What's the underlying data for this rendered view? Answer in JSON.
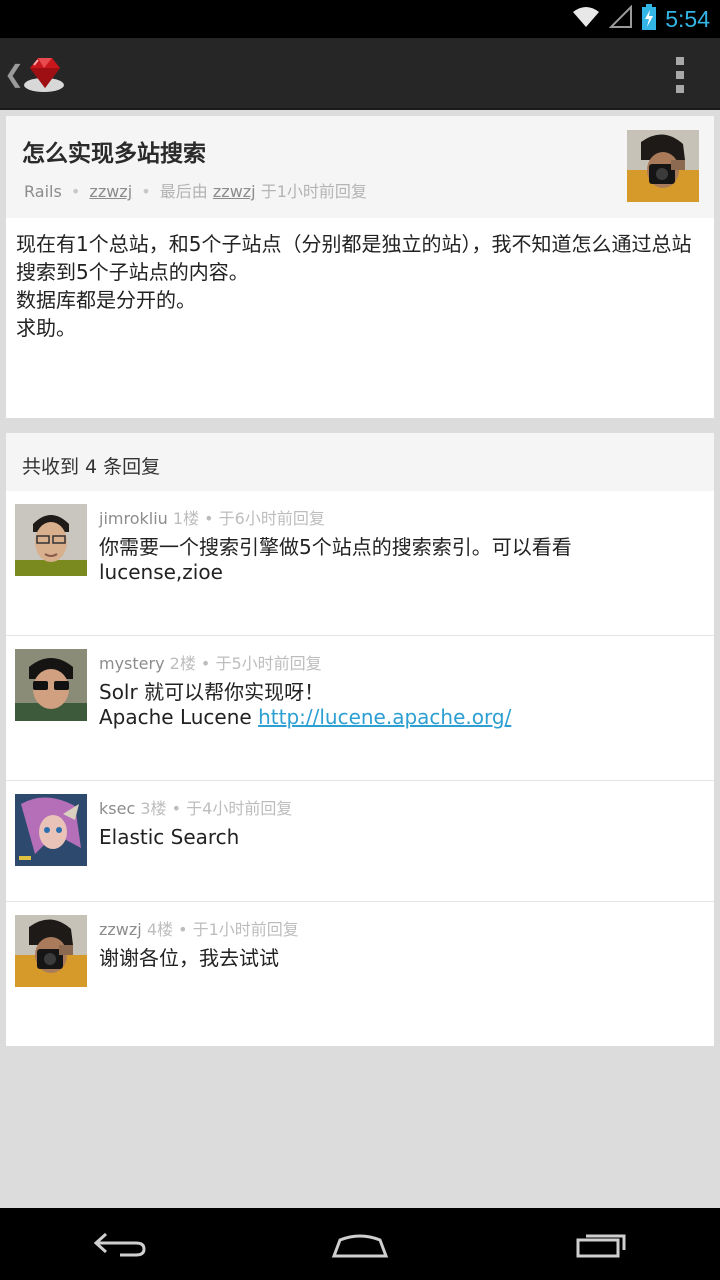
{
  "status_bar": {
    "time": "5:54",
    "icons": [
      "wifi-icon",
      "cellular-signal-icon",
      "battery-charging-icon"
    ]
  },
  "action_bar": {
    "up_icon": "chevron-left-icon",
    "logo": "ruby-gem-logo",
    "overflow_icon": "overflow-menu-icon"
  },
  "topic": {
    "title": "怎么实现多站搜索",
    "node": "Rails",
    "separator": "•",
    "author": "zzwzj",
    "last_reply_label": "最后由",
    "last_replier": "zzwzj",
    "last_reply_time": "于1小时前回复",
    "body_lines": [
      "现在有1个总站，和5个子站点（分别都是独立的站），我不知道怎么通过总站搜索到5个子站点的内容。",
      "数据库都是分开的。",
      "求助。"
    ]
  },
  "replies": {
    "count_label": "共收到 4 条回复",
    "items": [
      {
        "user": "jimrokliu",
        "floor_time": "1楼 • 于6小时前回复",
        "body": "你需要一个搜索引擎做5个站点的搜索索引。可以看看lucense,zioe",
        "link": ""
      },
      {
        "user": "mystery",
        "floor_time": "2楼 • 于5小时前回复",
        "body": "Solr 就可以帮你实现呀！",
        "body2": "Apache Lucene ",
        "link": "http://lucene.apache.org/"
      },
      {
        "user": "ksec",
        "floor_time": "3楼 • 于4小时前回复",
        "body": "Elastic Search",
        "link": ""
      },
      {
        "user": "zzwzj",
        "floor_time": "4楼 • 于1小时前回复",
        "body": "谢谢各位，我去试试",
        "link": ""
      }
    ]
  },
  "nav_bar": {
    "buttons": [
      "back-icon",
      "home-icon",
      "recent-apps-icon"
    ]
  },
  "colors": {
    "accent": "#33b5e5",
    "link": "#2d9fd2",
    "action_bar": "#262626",
    "background": "#dcdcdc"
  }
}
